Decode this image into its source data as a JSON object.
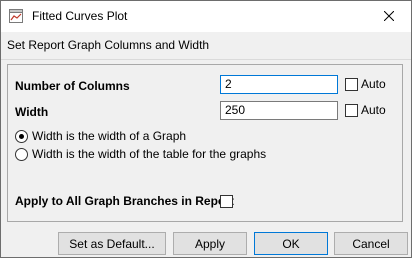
{
  "window": {
    "title": "Fitted Curves Plot"
  },
  "instruction": "Set Report Graph Columns and Width",
  "fields": {
    "columns": {
      "label": "Number of Columns",
      "value": "2",
      "auto_label": "Auto",
      "auto_checked": false
    },
    "width": {
      "label": "Width",
      "value": "250",
      "auto_label": "Auto",
      "auto_checked": false
    }
  },
  "width_mode": {
    "options": [
      {
        "label": "Width is the width of a Graph",
        "selected": true
      },
      {
        "label": "Width is the width of the table for the graphs",
        "selected": false
      }
    ]
  },
  "apply_all": {
    "label": "Apply to All Graph Branches in Report",
    "checked": false
  },
  "buttons": {
    "set_default": "Set as Default...",
    "apply": "Apply",
    "ok": "OK",
    "cancel": "Cancel"
  },
  "icons": {
    "app": "graph-window-icon",
    "close": "close-icon"
  },
  "colors": {
    "focus_border": "#0078d7",
    "dialog_bg": "#f0f0f0"
  }
}
